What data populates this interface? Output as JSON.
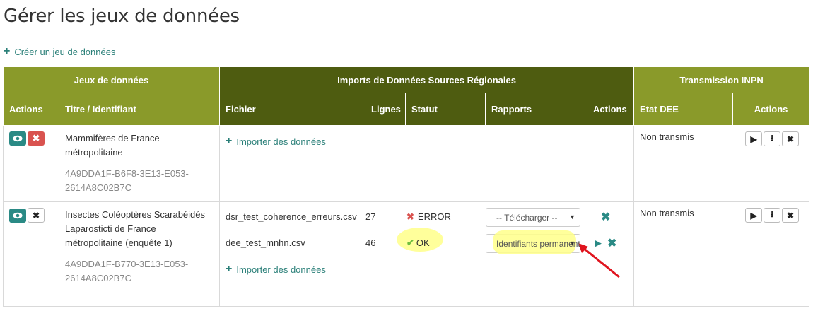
{
  "page": {
    "title": "Gérer les jeux de données",
    "create_link": "Créer un jeu de données"
  },
  "table": {
    "groups": [
      "Jeux de données",
      "Imports de Données Sources Régionales",
      "Transmission INPN"
    ],
    "columns": {
      "actions": "Actions",
      "title": "Titre / Identifiant",
      "file": "Fichier",
      "lines": "Lignes",
      "status": "Statut",
      "reports": "Rapports",
      "import_actions": "Actions",
      "etat": "Etat DEE",
      "transm_actions": "Actions"
    },
    "rows": [
      {
        "title": "Mammifères de France métropolitaine",
        "id": "4A9DDA1F-B6F8-3E13-E053-2614A8C02B7C",
        "import_link": "Importer des données",
        "etat": "Non transmis"
      },
      {
        "title": "Insectes Coléoptères Scarabéidés Laparosticti de France métropolitaine (enquête 1)",
        "id": "4A9DDA1F-B770-3E13-E053-2614A8C02B7C",
        "files": [
          {
            "name": "dsr_test_coherence_erreurs.csv",
            "lines": "27",
            "status": "ERROR",
            "report": "-- Télécharger --"
          },
          {
            "name": "dee_test_mnhn.csv",
            "lines": "46",
            "status": "OK",
            "report": "Identifiants permanents"
          }
        ],
        "import_link": "Importer des données",
        "etat": "Non transmis"
      }
    ]
  },
  "colors": {
    "header_green": "#8a9a2a",
    "header_dark": "#4e5c10",
    "teal": "#2a8a85",
    "danger": "#d9534f",
    "highlight": "#ffff8a",
    "arrow": "#e0141e"
  }
}
